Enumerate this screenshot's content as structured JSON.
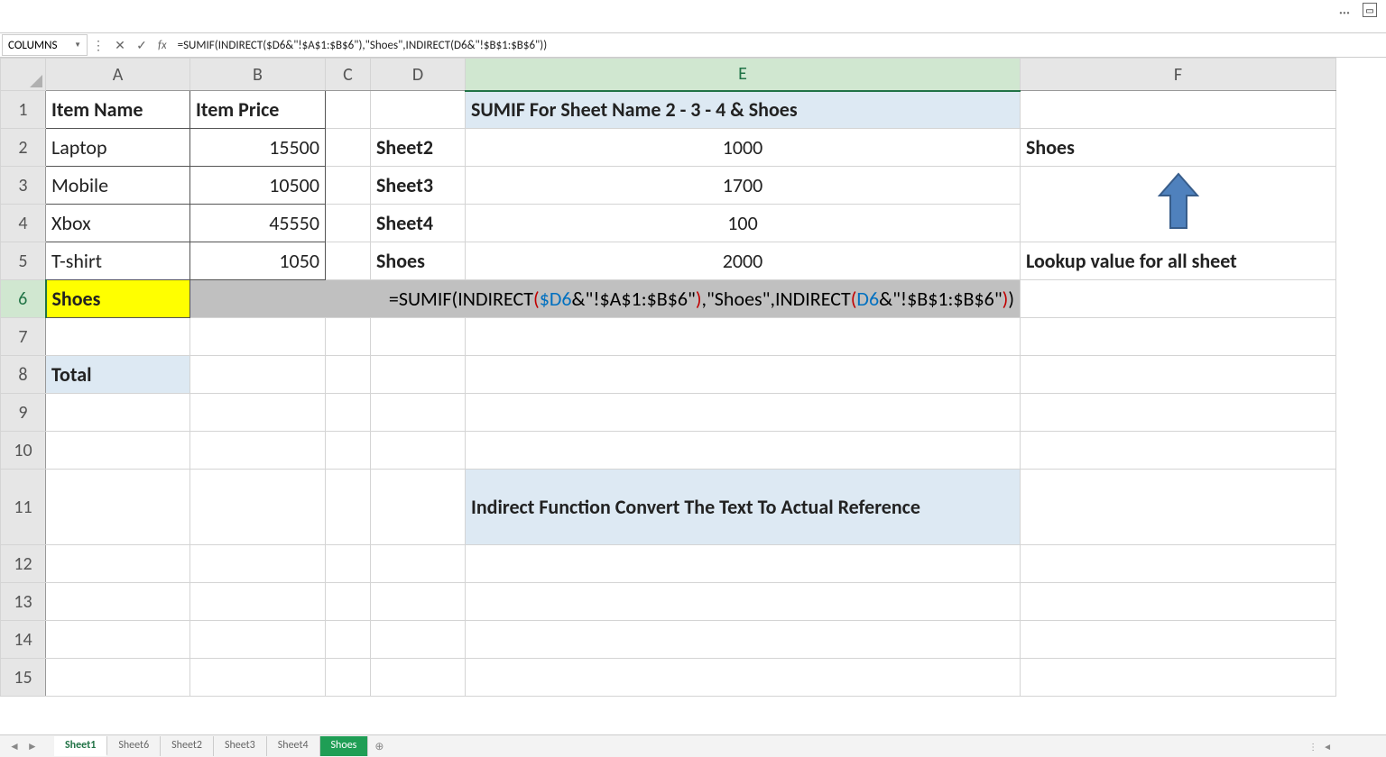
{
  "topbar": {
    "dots": "···"
  },
  "formula_bar": {
    "name_box": "COLUMNS",
    "formula_text": "=SUMIF(INDIRECT($D6&\"!$A$1:$B$6\"),\"Shoes\",INDIRECT(D6&\"!$B$1:$B$6\"))"
  },
  "columns": [
    "A",
    "B",
    "C",
    "D",
    "E",
    "F"
  ],
  "rows": [
    "1",
    "2",
    "3",
    "4",
    "5",
    "6",
    "7",
    "8",
    "9",
    "10",
    "11",
    "12",
    "13",
    "14",
    "15"
  ],
  "cells": {
    "A1": "Item Name",
    "B1": "Item Price",
    "E1": "SUMIF For Sheet Name 2 - 3 - 4 & Shoes",
    "A2": "Laptop",
    "B2": "15500",
    "D2": "Sheet2",
    "E2": "1000",
    "F2": "Shoes",
    "A3": "Mobile",
    "B3": "10500",
    "D3": "Sheet3",
    "E3": "1700",
    "A4": "Xbox",
    "B4": "45550",
    "D4": "Sheet4",
    "E4": "100",
    "A5": "T-shirt",
    "B5": "1050",
    "D5": "Shoes",
    "E5": "2000",
    "F5": "Lookup value for all sheet",
    "A6": "Shoes",
    "A8": "Total",
    "E11": "Indirect Function Convert The Text To Actual Reference"
  },
  "formula_tokens": [
    {
      "t": "=SUMIF",
      "c": "black"
    },
    {
      "t": "(",
      "c": "black"
    },
    {
      "t": "INDIRECT",
      "c": "black"
    },
    {
      "t": "(",
      "c": "red"
    },
    {
      "t": "$D6",
      "c": "blue"
    },
    {
      "t": "&\"!$A$1:$B$6\"",
      "c": "black"
    },
    {
      "t": ")",
      "c": "red"
    },
    {
      "t": ",\"Shoes\",",
      "c": "black"
    },
    {
      "t": "INDIRECT",
      "c": "black"
    },
    {
      "t": "(",
      "c": "red"
    },
    {
      "t": "D6",
      "c": "blue"
    },
    {
      "t": "&\"!$B$1:$B$6\"",
      "c": "black"
    },
    {
      "t": ")",
      "c": "red"
    },
    {
      "t": ")",
      "c": "black"
    }
  ],
  "sheet_tabs": {
    "items": [
      "Sheet1",
      "Sheet6",
      "Sheet2",
      "Sheet3",
      "Sheet4",
      "Shoes"
    ],
    "active": "Sheet1",
    "green": "Shoes"
  },
  "col_widths": {
    "A": 160,
    "B": 150,
    "C": 50,
    "D": 105,
    "E": 615,
    "F": 350
  }
}
